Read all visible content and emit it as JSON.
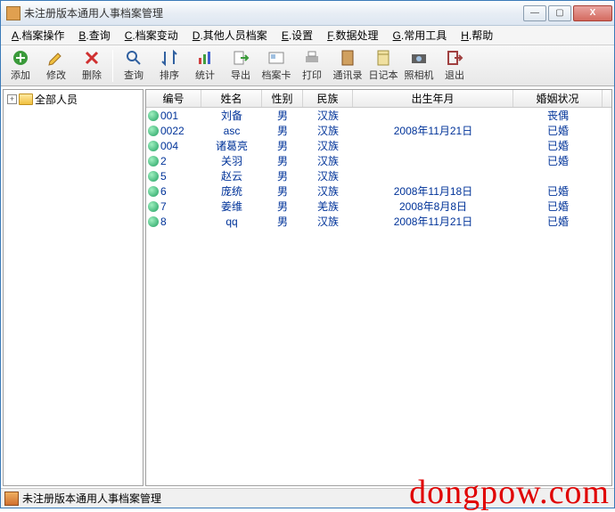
{
  "window": {
    "title": "未注册版本通用人事档案管理"
  },
  "winControls": {
    "min": "—",
    "max": "▢",
    "close": "X"
  },
  "menu": [
    {
      "key": "A",
      "label": "档案操作"
    },
    {
      "key": "B",
      "label": "查询"
    },
    {
      "key": "C",
      "label": "档案变动"
    },
    {
      "key": "D",
      "label": "其他人员档案"
    },
    {
      "key": "E",
      "label": "设置"
    },
    {
      "key": "F",
      "label": "数据处理"
    },
    {
      "key": "G",
      "label": "常用工具"
    },
    {
      "key": "H",
      "label": "帮助"
    }
  ],
  "toolbar": {
    "add": "添加",
    "edit": "修改",
    "del": "删除",
    "query": "查询",
    "sort": "排序",
    "stat": "统计",
    "export": "导出",
    "card": "档案卡",
    "print": "打印",
    "contact": "通讯录",
    "diary": "日记本",
    "camera": "照相机",
    "exit": "退出"
  },
  "tree": {
    "expand": "+",
    "root": "全部人员"
  },
  "columns": [
    "编号",
    "姓名",
    "性别",
    "民族",
    "出生年月",
    "婚姻状况"
  ],
  "rows": [
    {
      "id": "001",
      "name": "刘备",
      "sex": "男",
      "eth": "汉族",
      "dob": "",
      "mar": "丧偶"
    },
    {
      "id": "0022",
      "name": "asc",
      "sex": "男",
      "eth": "汉族",
      "dob": "2008年11月21日",
      "mar": "已婚"
    },
    {
      "id": "004",
      "name": "诸葛亮",
      "sex": "男",
      "eth": "汉族",
      "dob": "",
      "mar": "已婚"
    },
    {
      "id": "2",
      "name": "关羽",
      "sex": "男",
      "eth": "汉族",
      "dob": "",
      "mar": "已婚"
    },
    {
      "id": "5",
      "name": "赵云",
      "sex": "男",
      "eth": "汉族",
      "dob": "",
      "mar": ""
    },
    {
      "id": "6",
      "name": "庞统",
      "sex": "男",
      "eth": "汉族",
      "dob": "2008年11月18日",
      "mar": "已婚"
    },
    {
      "id": "7",
      "name": "姜维",
      "sex": "男",
      "eth": "羌族",
      "dob": "2008年8月8日",
      "mar": "已婚"
    },
    {
      "id": "8",
      "name": "qq",
      "sex": "男",
      "eth": "汉族",
      "dob": "2008年11月21日",
      "mar": "已婚"
    }
  ],
  "status": {
    "text": "未注册版本通用人事档案管理"
  },
  "watermark": "dongpow.com"
}
